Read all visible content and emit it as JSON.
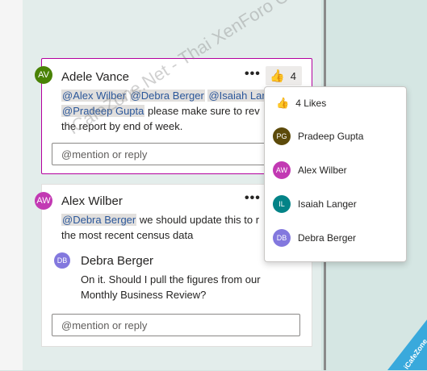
{
  "comments": [
    {
      "avatar": "AV",
      "avatar_color": "#498205",
      "author": "Adele Vance",
      "more_label": "•••",
      "likes": "4",
      "mentions": [
        "@Alex Wilber",
        "@Debra Berger",
        "@Isaiah Lang",
        "@Pradeep Gupta"
      ],
      "text_a": "please make sure to rev",
      "text_b": "the report by end of week.",
      "reply_placeholder": "@mention or reply"
    },
    {
      "avatar": "AW",
      "avatar_color": "#c239b3",
      "author": "Alex Wilber",
      "more_label": "•••",
      "mention": "@Debra Berger",
      "text_a": "we should update this to r",
      "text_b": "the most recent census data",
      "reply": {
        "avatar": "DB",
        "avatar_color": "#8378de",
        "author": "Debra Berger",
        "line1": "On it. Should I pull the figures from our",
        "line2": "Monthly Business Review?"
      },
      "reply_placeholder": "@mention or reply"
    }
  ],
  "likes_popup": {
    "count_label": "4 Likes",
    "people": [
      {
        "initials": "PG",
        "name": "Pradeep Gupta",
        "color": "#5c4a0a"
      },
      {
        "initials": "AW",
        "name": "Alex Wilber",
        "color": "#c239b3"
      },
      {
        "initials": "IL",
        "name": "Isaiah Langer",
        "color": "#038387"
      },
      {
        "initials": "DB",
        "name": "Debra Berger",
        "color": "#8378de"
      }
    ]
  },
  "watermark": "iCafeZone.Net - Thai XenForo Community",
  "brand": "iCafeZone"
}
